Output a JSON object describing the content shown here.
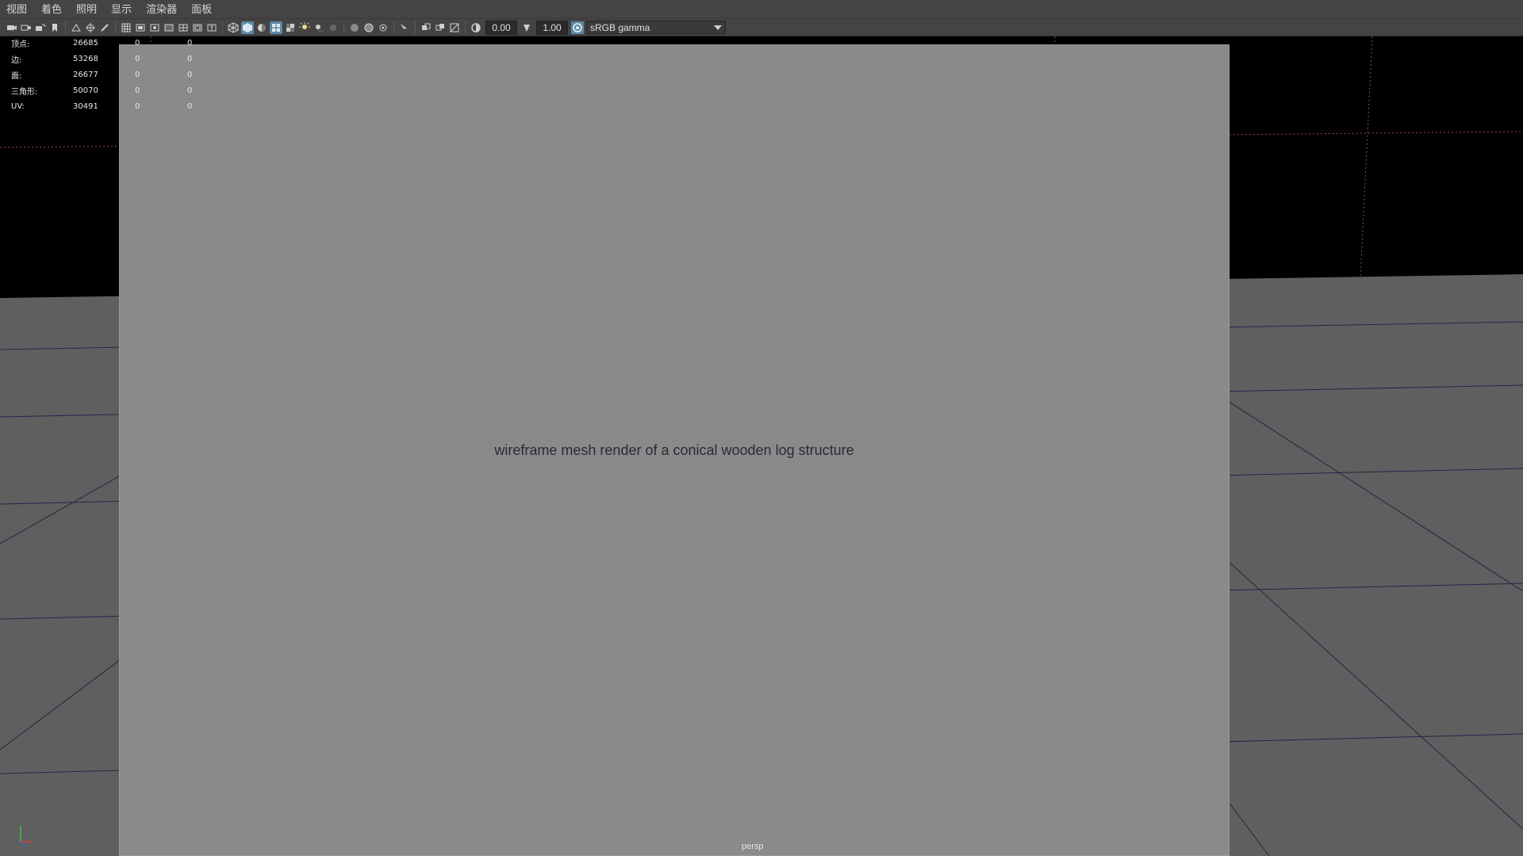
{
  "menubar": {
    "items": [
      "视图",
      "着色",
      "照明",
      "显示",
      "渲染器",
      "面板"
    ]
  },
  "toolbar": {
    "exposure_value": "0.00",
    "gamma_value": "1.00",
    "color_space": "sRGB gamma",
    "icons": [
      "camera-icon",
      "camera-attributes-icon",
      "bookmark-icon",
      "image-plane-icon",
      "grid-icon",
      "film-gate-icon",
      "resolution-gate-icon",
      "wireframe-icon",
      "smooth-shade-icon",
      "textured-icon",
      "lights-icon",
      "shadows-icon",
      "xray-icon",
      "isolate-select-icon",
      "exposure-icon",
      "gamma-icon",
      "color-management-icon"
    ]
  },
  "hud": {
    "rows": [
      {
        "label": "顶点:",
        "a": "26685",
        "b": "0",
        "c": "0"
      },
      {
        "label": "边:",
        "a": "53268",
        "b": "0",
        "c": "0"
      },
      {
        "label": "面:",
        "a": "26677",
        "b": "0",
        "c": "0"
      },
      {
        "label": "三角形:",
        "a": "50070",
        "b": "0",
        "c": "0"
      },
      {
        "label": "UV:",
        "a": "30491",
        "b": "0",
        "c": "0"
      }
    ]
  },
  "viewport": {
    "camera_label": "persp",
    "placeholder_label": "wireframe mesh render of a conical wooden log structure"
  },
  "colors": {
    "ui_bg": "#444444",
    "viewport_bg": "#000000",
    "floor": "#5f5f5f",
    "grid_line": "#24244a",
    "wire": "#1a1a55"
  }
}
